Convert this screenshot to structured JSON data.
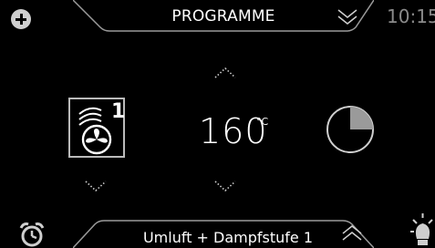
{
  "header": {
    "title": "PROGRAMME",
    "time": "10:15"
  },
  "main": {
    "fan_badge": "1",
    "temperature": "160",
    "temperature_unit": "°C",
    "timer_fill_fraction": 0.25
  },
  "footer": {
    "mode_label": "Umluft + Dampfstufe 1"
  },
  "icons": {
    "add": "plus-icon",
    "header_chevron": "chevron-down-icon",
    "temp_up": "chevron-up-icon",
    "temp_down": "chevron-down-icon",
    "fan_down": "chevron-down-icon",
    "footer_chevron": "chevron-up-icon",
    "alarm": "alarm-clock-icon",
    "light": "lamp-icon",
    "steam_fan": "steam-fan-icon",
    "timer": "timer-pie-icon"
  },
  "colors": {
    "background": "#000000",
    "outline": "#9a9a9a",
    "text": "#ffffff",
    "time": "#8a8a8a"
  }
}
